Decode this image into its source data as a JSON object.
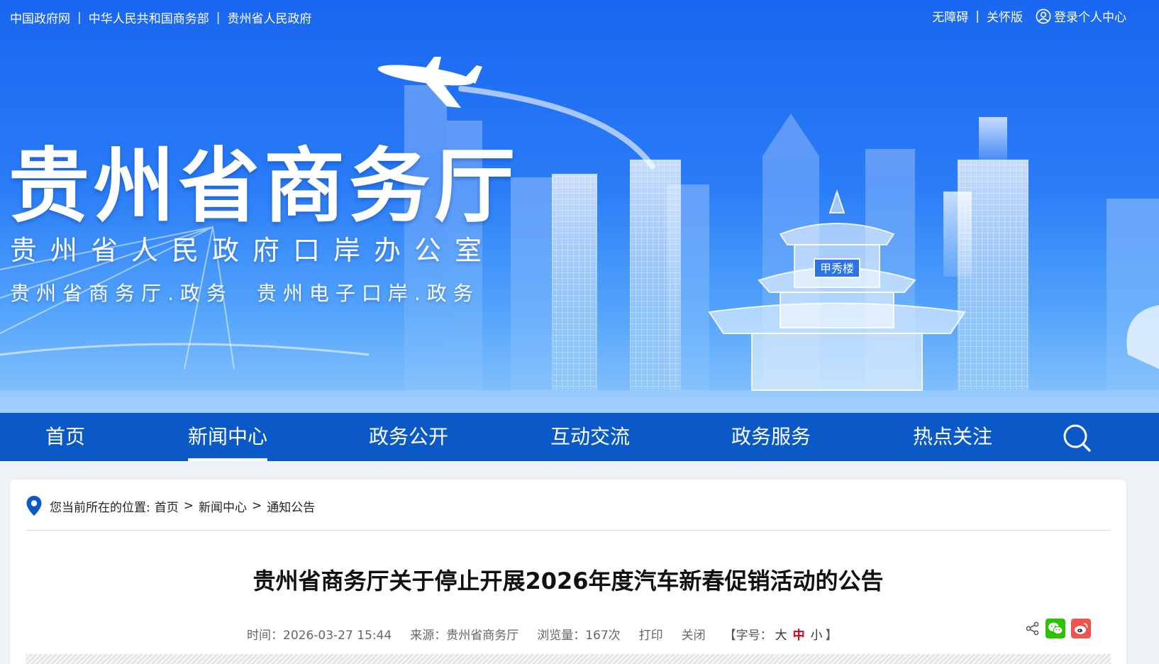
{
  "top_links": [
    "中国政府网",
    "中华人民共和国商务部",
    "贵州省人民政府"
  ],
  "top_right": {
    "accessibility": "无障碍",
    "care": "关怀版",
    "login": "登录个人中心"
  },
  "banner": {
    "title": "贵州省商务厅",
    "subtitle": "贵州省人民政府口岸办公室",
    "sub2_left": "贵州省商务厅.政务",
    "sub2_right": "贵州电子口岸.政务",
    "pavilion_plaque": "甲秀楼"
  },
  "nav": [
    "首页",
    "新闻中心",
    "政务公开",
    "互动交流",
    "政务服务",
    "热点关注"
  ],
  "nav_active": "新闻中心",
  "breadcrumb": {
    "prefix": "您当前所在的位置:",
    "items": [
      "首页",
      "新闻中心",
      "通知公告"
    ],
    "sep": ">"
  },
  "article": {
    "title": "贵州省商务厅关于停止开展2026年度汽车新春促销活动的公告",
    "time": "时间：2026-03-27 15:44",
    "source": "来源：贵州省商务厅",
    "views": "浏览量：167次",
    "print": "打印",
    "close": "关闭",
    "font_label_open": "【字号：",
    "font_sizes": [
      "大",
      "中",
      "小"
    ],
    "font_current": "中",
    "font_label_close": "】"
  },
  "colors": {
    "nav_bg": "#0a59c6",
    "banner_top": "#1a66f0",
    "accent_red": "#d9001b",
    "wechat": "#2dc100",
    "weibo": "#e6162d"
  },
  "icons": [
    "user-icon",
    "search-icon",
    "location-pin-icon",
    "share-icon",
    "wechat-icon",
    "weibo-icon"
  ]
}
